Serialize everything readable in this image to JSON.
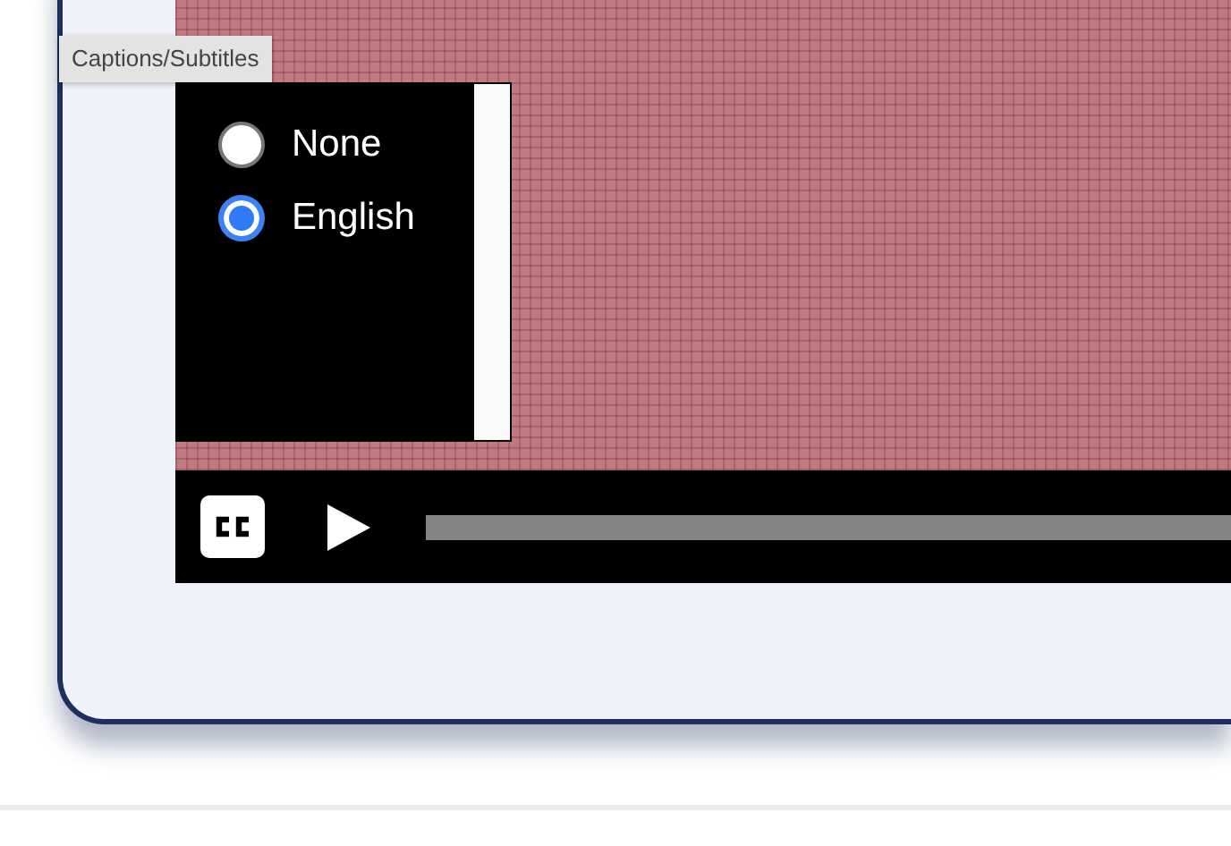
{
  "tooltip": {
    "text": "Captions/Subtitles"
  },
  "captions_menu": {
    "options": [
      {
        "label": "None",
        "selected": false
      },
      {
        "label": "English",
        "selected": true
      }
    ]
  },
  "controls": {
    "buttons": [
      {
        "kind": "captions"
      },
      {
        "kind": "play"
      }
    ]
  }
}
